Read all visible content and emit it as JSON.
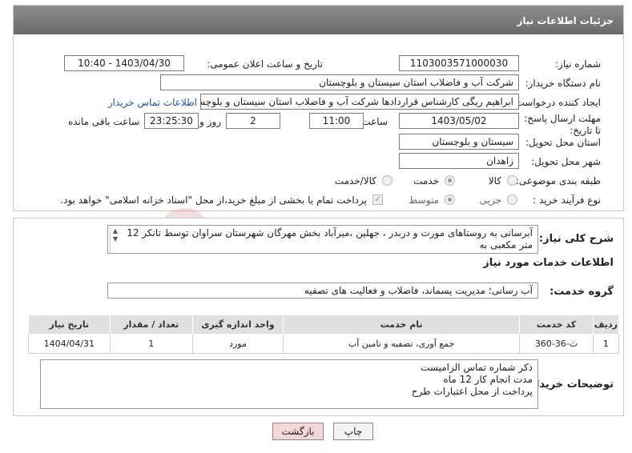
{
  "header": {
    "title": "جزئیات اطلاعات نیاز"
  },
  "fields": {
    "need_number_label": "شماره نیاز:",
    "need_number": "1103003571000030",
    "announce_label": "تاریخ و ساعت اعلان عمومی:",
    "announce_value": "1403/04/30 - 10:40",
    "buyer_label": "نام دستگاه خریدار:",
    "buyer": "شرکت آب و فاضلاب استان سیستان و بلوچستان",
    "creator_label": "ایجاد کننده درخواست:",
    "creator": "ابراهیم ریگی کارشناس قراردادها شرکت آب و فاضلاب استان سیستان و بلوچستان",
    "contact_link": "اطلاعات تماس خریدار",
    "deadline_label": "مهلت ارسال پاسخ: تا تاریخ:",
    "deadline_date": "1403/05/02",
    "time_label": "ساعت",
    "deadline_time": "11:00",
    "days_value": "2",
    "days_label": "روز و",
    "remaining_time": "23:25:30",
    "remaining_label": "ساعت باقی مانده",
    "province_label": "استان محل تحویل:",
    "province": "سیستان و بلوچستان",
    "city_label": "شهر محل تحویل:",
    "city": "زاهدان",
    "category_label": "طبقه بندی موضوعی:",
    "cat_goods": "کالا",
    "cat_service": "خدمت",
    "cat_goods_service": "کالا/خدمت",
    "process_label": "نوع فرآیند خرید :",
    "proc_partial": "جزیی",
    "proc_medium": "متوسط",
    "payment_note": "پرداخت تمام یا بخشی از مبلغ خرید،از محل \"اسناد خزانه اسلامی\" خواهد بود."
  },
  "details": {
    "summary_label": "شرح کلی نیاز:",
    "summary": "آبرسانی به روستاهای مورت و دربدر ، جهلین ،میرآباد بخش مهرگان شهرستان سراوان توسط تانکر 12 متر مکعبی به",
    "services_heading": "اطلاعات خدمات مورد نیاز",
    "service_group_label": "گروه خدمت:",
    "service_group": "آب رسانی؛ مدیریت پسماند، فاضلاب و فعالیت های تصفیه",
    "table": {
      "headers": [
        "ردیف",
        "کد خدمت",
        "نام خدمت",
        "واحد اندازه گیری",
        "تعداد / مقدار",
        "تاریخ نیاز"
      ],
      "rows": [
        [
          "1",
          "ث-36-360",
          "جمع آوری، تصفیه و تامین آب",
          "مورد",
          "1",
          "1404/04/31"
        ]
      ]
    },
    "buyer_notes_label": "توضیحات خریدار:",
    "buyer_notes": [
      "ذکر شماره تماس الزامیست",
      "مدت انجام کار 12 ماه",
      "پرداخت از محل اعتبارات طرح"
    ]
  },
  "buttons": {
    "print": "چاپ",
    "back": "بازگشت"
  },
  "watermark": "AriaTender.neT"
}
